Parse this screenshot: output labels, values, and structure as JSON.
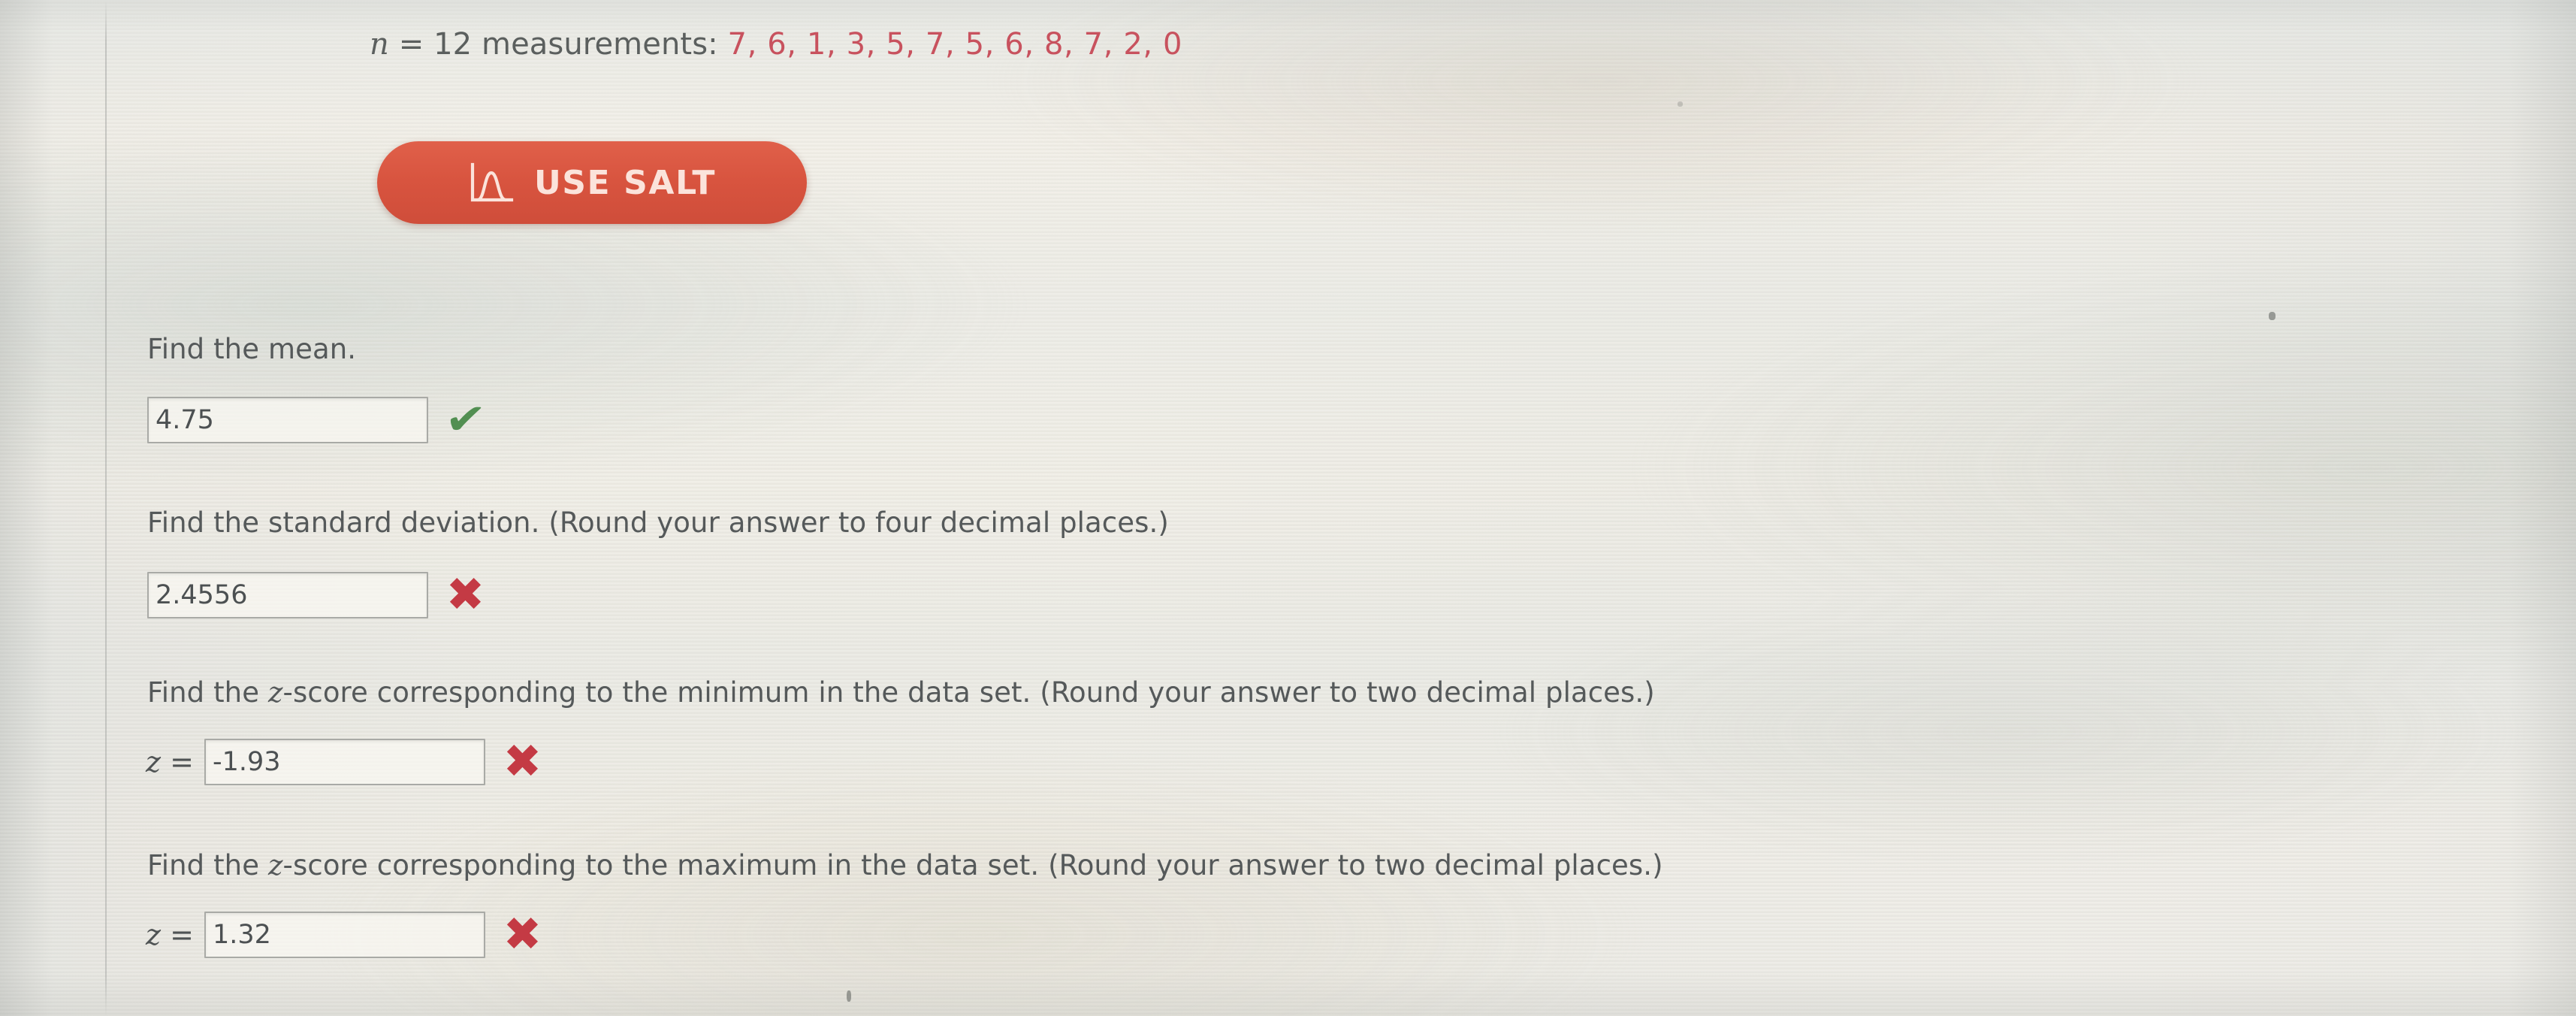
{
  "problem": {
    "n_label_prefix": "n",
    "n_label_rest": " = 12 measurements: ",
    "measurements_text": "7, 6, 1, 3, 5, 7, 5, 6, 8, 7, 2, 0",
    "measurements": [
      7,
      6,
      1,
      3,
      5,
      7,
      5,
      6,
      8,
      7,
      2,
      0
    ],
    "n": 12
  },
  "salt_button": {
    "label": "USE SALT",
    "icon": "normal-distribution-curve-icon",
    "background_color": "#d8543f",
    "text_color": "#fbe3db"
  },
  "questions": [
    {
      "prompt": "Find the mean.",
      "label": "",
      "value": "4.75",
      "status": "correct",
      "status_glyph": "✔",
      "status_color": "#528f52"
    },
    {
      "prompt": "Find the standard deviation. (Round your answer to four decimal places.)",
      "label": "",
      "value": "2.4556",
      "status": "incorrect",
      "status_glyph": "✖",
      "status_color": "#c43a44"
    },
    {
      "prompt_pre": "Find the ",
      "prompt_ital": "z",
      "prompt_post": "-score corresponding to the minimum in the data set. (Round your answer to two decimal places.)",
      "label_ital": "z",
      "label_post": " = ",
      "value": "-1.93",
      "status": "incorrect",
      "status_glyph": "✖",
      "status_color": "#c43a44"
    },
    {
      "prompt_pre": "Find the ",
      "prompt_ital": "z",
      "prompt_post": "-score corresponding to the maximum in the data set. (Round your answer to two decimal places.)",
      "label_ital": "z",
      "label_post": " = ",
      "value": "1.32",
      "status": "incorrect",
      "status_glyph": "✖",
      "status_color": "#c43a44"
    }
  ],
  "colors": {
    "measurement_values": "#c8525e",
    "body_text": "#55595a",
    "page_background": "#eceae2"
  }
}
